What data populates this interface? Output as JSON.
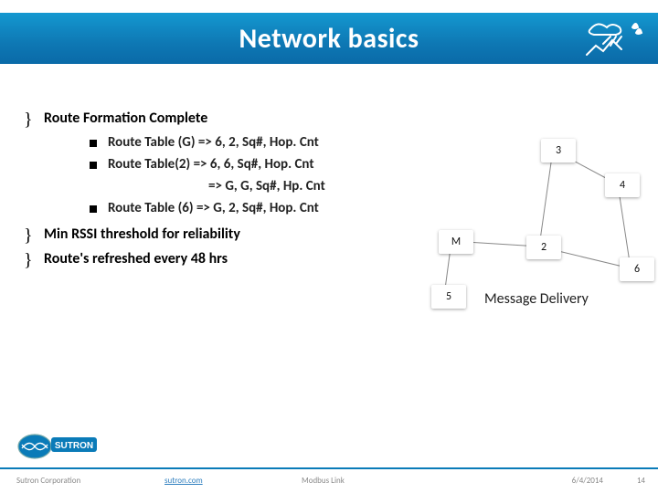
{
  "header": {
    "title": "Network basics"
  },
  "bullets": [
    {
      "text": "Route Formation Complete"
    },
    {
      "text": "Min RSSI threshold for reliability"
    },
    {
      "text": "Route's refreshed every 48 hrs"
    }
  ],
  "sub_items": [
    "Route Table (G) => 6, 2, Sq#, Hop. Cnt",
    "Route Table(2) => 6, 6, Sq#, Hop. Cnt",
    "Route Table (6) => G, 2, Sq#, Hop. Cnt"
  ],
  "sub_indent": "=> G, G, Sq#, Hp. Cnt",
  "diagram": {
    "nodes": {
      "n3": "3",
      "n4": "4",
      "nM": "M",
      "n2": "2",
      "n6": "6",
      "n5": "5"
    },
    "label": "Message Delivery"
  },
  "footer": {
    "company": "Sutron Corporation",
    "url": "sutron.com",
    "product": "Modbus Link",
    "date": "6/4/2014",
    "page": "14"
  },
  "colors": {
    "banner_top": "#1498d0",
    "banner_bottom": "#0a6aa8",
    "accent": "#0a7bb8"
  }
}
